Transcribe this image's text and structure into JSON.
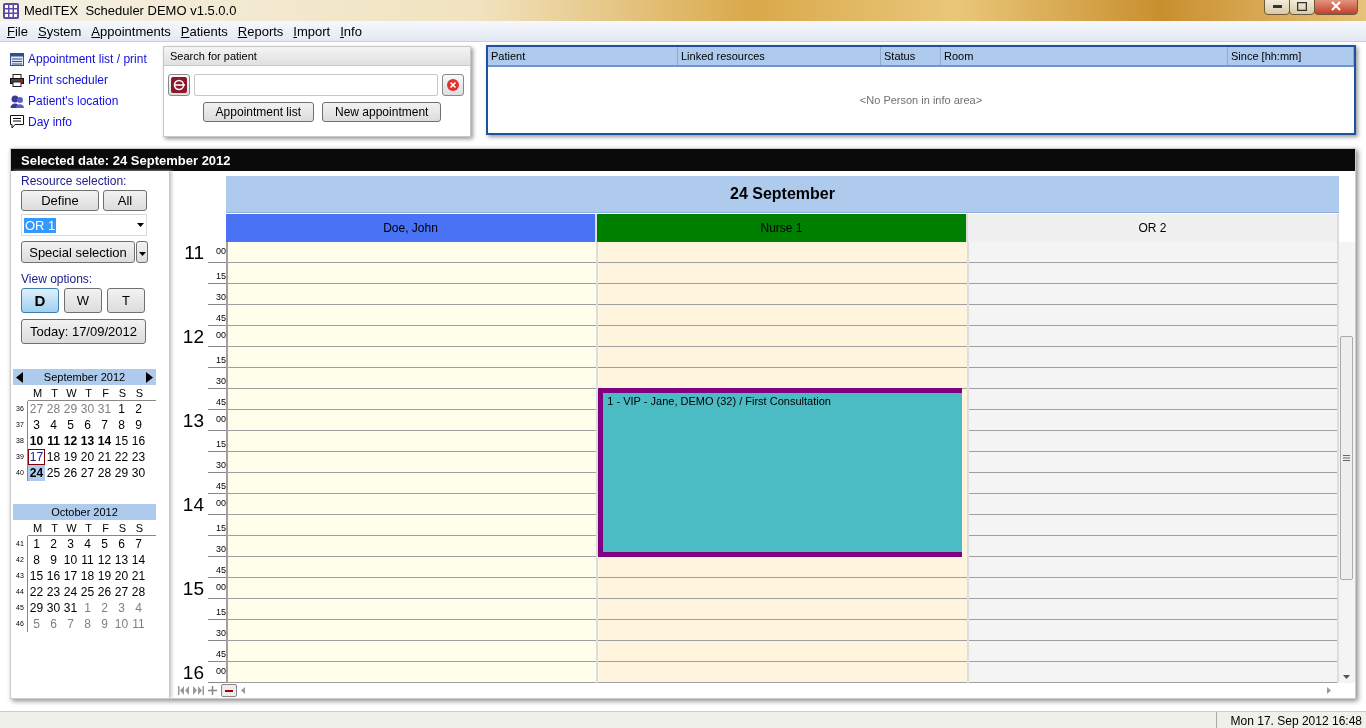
{
  "window": {
    "title": "MedITEX  Scheduler DEMO v1.5.0.0"
  },
  "menu": [
    "File",
    "System",
    "Appointments",
    "Patients",
    "Reports",
    "Import",
    "Info"
  ],
  "quick_links": [
    {
      "label": "Appointment list / print",
      "kind": "list"
    },
    {
      "label": "Print scheduler",
      "kind": "printer"
    },
    {
      "label": "Patient's location",
      "kind": "people"
    },
    {
      "label": "Day info",
      "kind": "note"
    }
  ],
  "search": {
    "title": "Search for patient",
    "buttons": [
      "Appointment list",
      "New appointment"
    ]
  },
  "info_area": {
    "columns": [
      "Patient",
      "Linked resources",
      "Status",
      "Room",
      "Since [hh:mm]"
    ],
    "empty_text": "<No Person in info area>"
  },
  "selected_date": "Selected date: 24 September 2012",
  "sidebar": {
    "resource_label": "Resource selection:",
    "resource_buttons": [
      "Define",
      "All"
    ],
    "resource_value": "OR 1",
    "special_button": "Special selection",
    "view_label": "View options:",
    "view_buttons": [
      {
        "label": "D",
        "selected": true
      },
      {
        "label": "W",
        "selected": false
      },
      {
        "label": "T",
        "selected": false
      }
    ],
    "today_button": "Today: 17/09/2012",
    "calendars": [
      {
        "title": "September 2012",
        "arrows": true,
        "weekdays": [
          "M",
          "T",
          "W",
          "T",
          "F",
          "S",
          "S"
        ],
        "weeks": [
          {
            "week": "36",
            "days": [
              {
                "day": "27",
                "kind": "outside"
              },
              {
                "day": "28",
                "kind": "outside"
              },
              {
                "day": "29",
                "kind": "outside"
              },
              {
                "day": "30",
                "kind": "outside"
              },
              {
                "day": "31",
                "kind": "outside"
              },
              {
                "day": "1",
                "kind": "plain"
              },
              {
                "day": "2",
                "kind": "plain"
              }
            ]
          },
          {
            "week": "37",
            "days": [
              {
                "day": "3",
                "kind": "plain"
              },
              {
                "day": "4",
                "kind": "plain"
              },
              {
                "day": "5",
                "kind": "plain"
              },
              {
                "day": "6",
                "kind": "plain"
              },
              {
                "day": "7",
                "kind": "plain"
              },
              {
                "day": "8",
                "kind": "plain"
              },
              {
                "day": "9",
                "kind": "plain"
              }
            ]
          },
          {
            "week": "38",
            "days": [
              {
                "day": "10",
                "kind": "busy"
              },
              {
                "day": "11",
                "kind": "busy"
              },
              {
                "day": "12",
                "kind": "busy"
              },
              {
                "day": "13",
                "kind": "busy"
              },
              {
                "day": "14",
                "kind": "busy"
              },
              {
                "day": "15",
                "kind": "plain"
              },
              {
                "day": "16",
                "kind": "plain"
              }
            ]
          },
          {
            "week": "39",
            "days": [
              {
                "day": "17",
                "kind": "today"
              },
              {
                "day": "18",
                "kind": "plain"
              },
              {
                "day": "19",
                "kind": "plain"
              },
              {
                "day": "20",
                "kind": "plain"
              },
              {
                "day": "21",
                "kind": "plain"
              },
              {
                "day": "22",
                "kind": "plain"
              },
              {
                "day": "23",
                "kind": "plain"
              }
            ]
          },
          {
            "week": "40",
            "days": [
              {
                "day": "24",
                "kind": "selected"
              },
              {
                "day": "25",
                "kind": "plain"
              },
              {
                "day": "26",
                "kind": "plain"
              },
              {
                "day": "27",
                "kind": "plain"
              },
              {
                "day": "28",
                "kind": "plain"
              },
              {
                "day": "29",
                "kind": "plain"
              },
              {
                "day": "30",
                "kind": "plain"
              }
            ]
          }
        ]
      },
      {
        "title": "October 2012",
        "arrows": false,
        "weekdays": [
          "M",
          "T",
          "W",
          "T",
          "F",
          "S",
          "S"
        ],
        "weeks": [
          {
            "week": "41",
            "days": [
              {
                "day": "1",
                "kind": "plain"
              },
              {
                "day": "2",
                "kind": "plain"
              },
              {
                "day": "3",
                "kind": "plain"
              },
              {
                "day": "4",
                "kind": "plain"
              },
              {
                "day": "5",
                "kind": "plain"
              },
              {
                "day": "6",
                "kind": "plain"
              },
              {
                "day": "7",
                "kind": "plain"
              }
            ]
          },
          {
            "week": "42",
            "days": [
              {
                "day": "8",
                "kind": "plain"
              },
              {
                "day": "9",
                "kind": "plain"
              },
              {
                "day": "10",
                "kind": "plain"
              },
              {
                "day": "11",
                "kind": "plain"
              },
              {
                "day": "12",
                "kind": "plain"
              },
              {
                "day": "13",
                "kind": "plain"
              },
              {
                "day": "14",
                "kind": "plain"
              }
            ]
          },
          {
            "week": "43",
            "days": [
              {
                "day": "15",
                "kind": "plain"
              },
              {
                "day": "16",
                "kind": "plain"
              },
              {
                "day": "17",
                "kind": "plain"
              },
              {
                "day": "18",
                "kind": "plain"
              },
              {
                "day": "19",
                "kind": "plain"
              },
              {
                "day": "20",
                "kind": "plain"
              },
              {
                "day": "21",
                "kind": "plain"
              }
            ]
          },
          {
            "week": "44",
            "days": [
              {
                "day": "22",
                "kind": "plain"
              },
              {
                "day": "23",
                "kind": "plain"
              },
              {
                "day": "24",
                "kind": "plain"
              },
              {
                "day": "25",
                "kind": "plain"
              },
              {
                "day": "26",
                "kind": "plain"
              },
              {
                "day": "27",
                "kind": "plain"
              },
              {
                "day": "28",
                "kind": "plain"
              }
            ]
          },
          {
            "week": "45",
            "days": [
              {
                "day": "29",
                "kind": "plain"
              },
              {
                "day": "30",
                "kind": "plain"
              },
              {
                "day": "31",
                "kind": "plain"
              },
              {
                "day": "1",
                "kind": "outside"
              },
              {
                "day": "2",
                "kind": "outside"
              },
              {
                "day": "3",
                "kind": "outside"
              },
              {
                "day": "4",
                "kind": "outside"
              }
            ]
          },
          {
            "week": "46",
            "days": [
              {
                "day": "5",
                "kind": "outside"
              },
              {
                "day": "6",
                "kind": "outside"
              },
              {
                "day": "7",
                "kind": "outside"
              },
              {
                "day": "8",
                "kind": "outside"
              },
              {
                "day": "9",
                "kind": "outside"
              },
              {
                "day": "10",
                "kind": "outside"
              },
              {
                "day": "11",
                "kind": "outside"
              }
            ]
          }
        ]
      }
    ]
  },
  "schedule": {
    "day_title": "24 September",
    "resources": [
      {
        "name": "Doe, John",
        "color": "#4a72f5",
        "slots": [
          {
            "kind": "free"
          },
          {
            "kind": "free"
          },
          {
            "kind": "free"
          },
          {
            "kind": "free"
          },
          {
            "kind": "free"
          },
          {
            "kind": "free"
          },
          {
            "kind": "free"
          },
          {
            "kind": "free"
          },
          {
            "kind": "free"
          },
          {
            "kind": "free"
          },
          {
            "kind": "free"
          },
          {
            "kind": "free"
          },
          {
            "kind": "free"
          },
          {
            "kind": "free"
          },
          {
            "kind": "free"
          },
          {
            "kind": "free"
          },
          {
            "kind": "free"
          },
          {
            "kind": "free"
          },
          {
            "kind": "free"
          },
          {
            "kind": "free"
          },
          {
            "kind": "free"
          }
        ]
      },
      {
        "name": "Nurse 1",
        "color": "#008000",
        "slots": [
          {
            "kind": "free"
          },
          {
            "kind": "free"
          },
          {
            "kind": "free"
          },
          {
            "kind": "free"
          },
          {
            "kind": "free"
          },
          {
            "kind": "free"
          },
          {
            "kind": "free"
          },
          {
            "kind": "appointment",
            "text": "1 - VIP - Jane, DEMO (32) / First Consultation",
            "color": "#4bbcc4"
          },
          {
            "kind": "booked"
          },
          {
            "kind": "booked"
          },
          {
            "kind": "booked"
          },
          {
            "kind": "booked"
          },
          {
            "kind": "booked"
          },
          {
            "kind": "booked"
          },
          {
            "kind": "booked"
          },
          {
            "kind": "free"
          },
          {
            "kind": "free"
          },
          {
            "kind": "free"
          },
          {
            "kind": "free"
          },
          {
            "kind": "free"
          },
          {
            "kind": "free"
          }
        ]
      },
      {
        "name": "OR 2",
        "color": "#f0f0f0",
        "slots": [
          {
            "kind": "free"
          },
          {
            "kind": "free"
          },
          {
            "kind": "free"
          },
          {
            "kind": "free"
          },
          {
            "kind": "free"
          },
          {
            "kind": "free"
          },
          {
            "kind": "free"
          },
          {
            "kind": "free"
          },
          {
            "kind": "free"
          },
          {
            "kind": "free"
          },
          {
            "kind": "free"
          },
          {
            "kind": "free"
          },
          {
            "kind": "free"
          },
          {
            "kind": "free"
          },
          {
            "kind": "free"
          },
          {
            "kind": "free"
          },
          {
            "kind": "free"
          },
          {
            "kind": "free"
          },
          {
            "kind": "free"
          },
          {
            "kind": "free"
          },
          {
            "kind": "free"
          }
        ]
      }
    ],
    "time_slots": [
      {
        "hour": "11",
        "minute": "00"
      },
      {
        "minute": "15"
      },
      {
        "minute": "30"
      },
      {
        "minute": "45"
      },
      {
        "hour": "12",
        "minute": "00"
      },
      {
        "minute": "15"
      },
      {
        "minute": "30"
      },
      {
        "minute": "45"
      },
      {
        "hour": "13",
        "minute": "00"
      },
      {
        "minute": "15"
      },
      {
        "minute": "30"
      },
      {
        "minute": "45"
      },
      {
        "hour": "14",
        "minute": "00"
      },
      {
        "minute": "15"
      },
      {
        "minute": "30"
      },
      {
        "minute": "45"
      },
      {
        "hour": "15",
        "minute": "00"
      },
      {
        "minute": "15"
      },
      {
        "minute": "30"
      },
      {
        "minute": "45"
      },
      {
        "hour": "16",
        "minute": "00"
      }
    ]
  },
  "status_bar": {
    "datetime": "Mon 17. Sep 2012 16:48"
  }
}
